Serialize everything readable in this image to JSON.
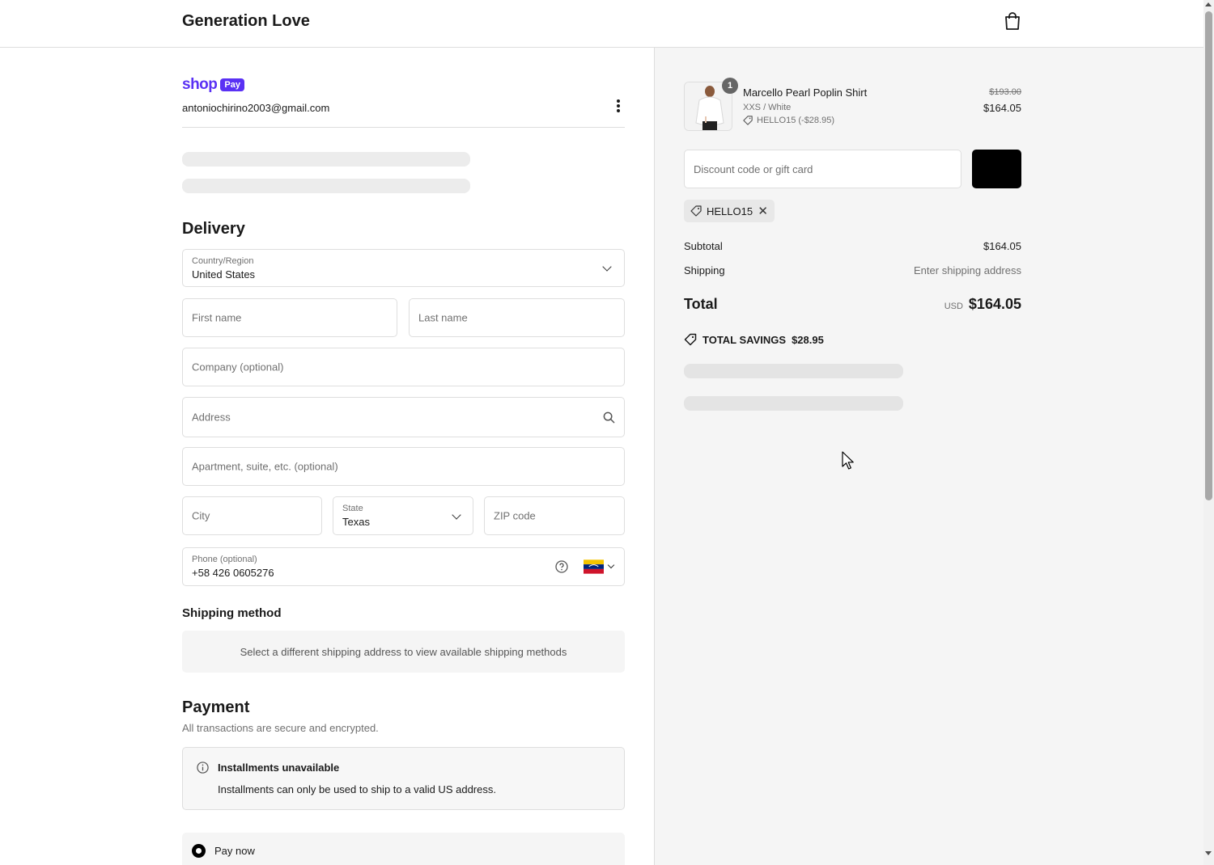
{
  "header": {
    "brand": "Generation Love"
  },
  "account": {
    "shop_label": "shop",
    "pay_label": "Pay",
    "email": "antoniochirino2003@gmail.com"
  },
  "delivery": {
    "title": "Delivery",
    "country": {
      "label": "Country/Region",
      "value": "United States"
    },
    "first_name_placeholder": "First name",
    "last_name_placeholder": "Last name",
    "company_placeholder": "Company (optional)",
    "address_placeholder": "Address",
    "apartment_placeholder": "Apartment, suite, etc. (optional)",
    "city_placeholder": "City",
    "state": {
      "label": "State",
      "value": "Texas"
    },
    "zip_placeholder": "ZIP code",
    "phone": {
      "label": "Phone (optional)",
      "value": "+58 426 0605276"
    }
  },
  "shipping_method": {
    "title": "Shipping method",
    "message": "Select a different shipping address to view available shipping methods"
  },
  "payment": {
    "title": "Payment",
    "subtitle": "All transactions are secure and encrypted.",
    "installments_title": "Installments unavailable",
    "installments_text": "Installments can only be used to ship to a valid US address.",
    "pay_now_label": "Pay now"
  },
  "summary": {
    "product": {
      "quantity": "1",
      "name": "Marcello Pearl Poplin Shirt",
      "variant": "XXS / White",
      "discount": "HELLO15 (-$28.95)",
      "original_price": "$193.00",
      "price": "$164.05"
    },
    "discount_placeholder": "Discount code or gift card",
    "applied_code": "HELLO15",
    "subtotal_label": "Subtotal",
    "subtotal_value": "$164.05",
    "shipping_label": "Shipping",
    "shipping_value": "Enter shipping address",
    "total_label": "Total",
    "total_currency": "USD",
    "total_value": "$164.05",
    "savings_label": "TOTAL SAVINGS",
    "savings_value": "$28.95"
  },
  "colors": {
    "shop_pay_purple": "#5a31f4",
    "panel_gray": "#f5f5f5",
    "border": "#dedede"
  }
}
